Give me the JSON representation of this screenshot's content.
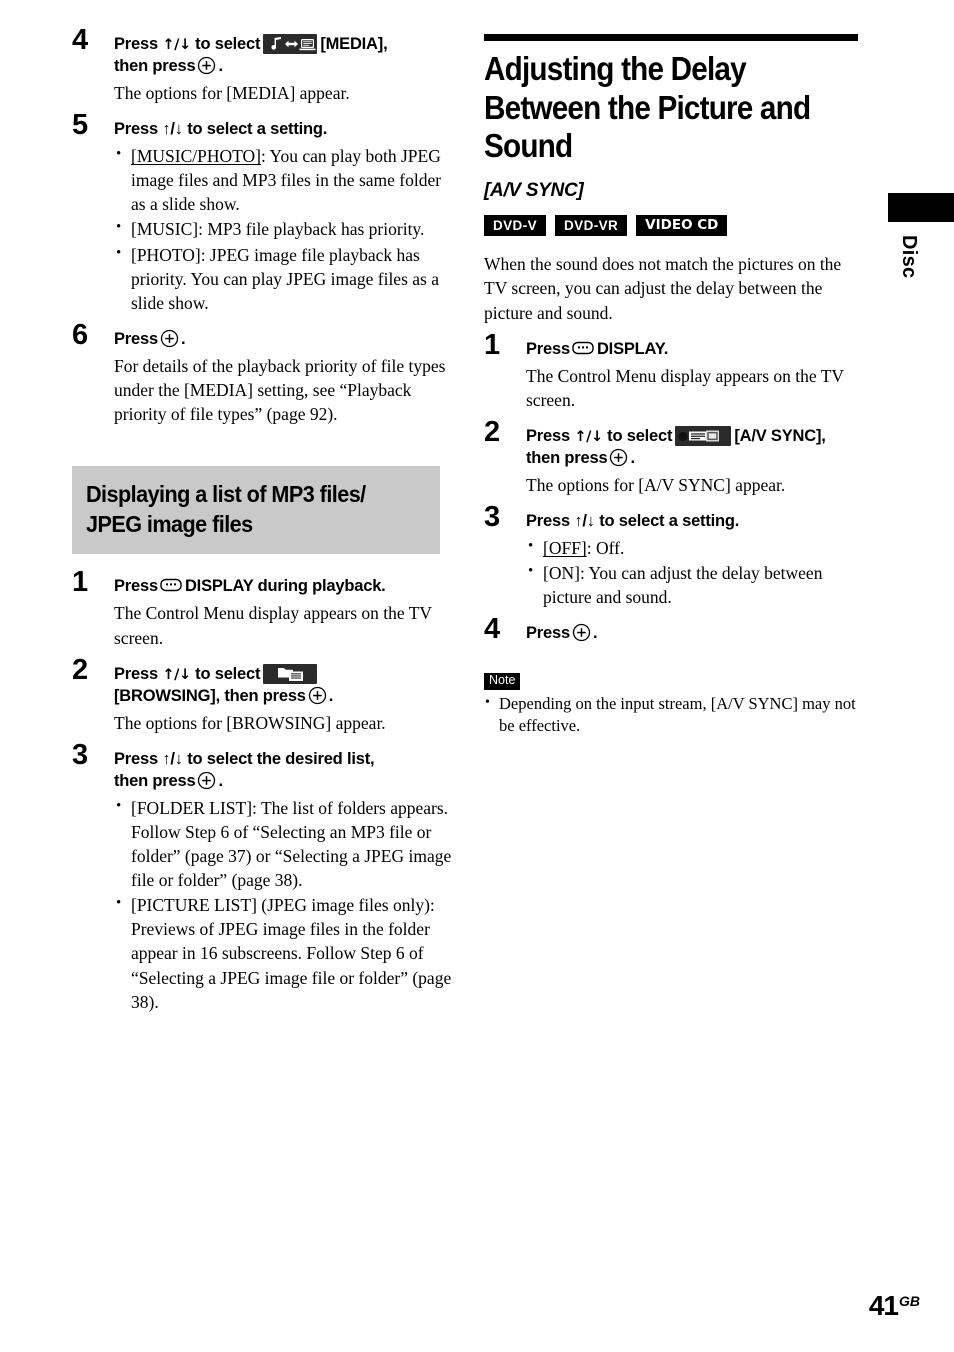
{
  "page": {
    "number": "41",
    "region_suffix": "GB",
    "side_tab_label": "Disc"
  },
  "left_column": {
    "steps_continued": [
      {
        "num": "4",
        "head_before": "Press",
        "arrows": "↑/↓",
        "head_mid": "to select",
        "icon": "media-icon",
        "head_after": "[MEDIA],",
        "head_line2_before": "then press",
        "head_line2_after": ".",
        "body": "The options for [MEDIA] appear."
      },
      {
        "num": "5",
        "head": "Press ↑/↓ to select a setting.",
        "bullets": [
          {
            "label": "[MUSIC/PHOTO]",
            "underline": true,
            "text": ": You can play both JPEG image files and MP3 files in the same folder as a slide show."
          },
          {
            "label": "[MUSIC]",
            "underline": false,
            "text": ": MP3 file playback has priority."
          },
          {
            "label": "[PHOTO]",
            "underline": false,
            "text": ": JPEG image file playback has priority. You can play JPEG image files as a slide show."
          }
        ]
      },
      {
        "num": "6",
        "head_before": "Press",
        "head_after": ".",
        "body": "For details of the playback priority of file types under the [MEDIA] setting, see “Playback priority of file types” (page 92)."
      }
    ],
    "gray_heading": "Displaying a list of MP3 files/ JPEG image files",
    "steps": [
      {
        "num": "1",
        "head_before": "Press",
        "head_after": "DISPLAY during playback.",
        "body": "The Control Menu display appears on the TV screen."
      },
      {
        "num": "2",
        "head_before": "Press",
        "arrows": "↑/↓",
        "head_mid": "to select",
        "icon": "browsing-icon",
        "head_line2_before": "[BROWSING], then press",
        "head_line2_after": ".",
        "body": "The options for [BROWSING] appear."
      },
      {
        "num": "3",
        "head_line1": "Press ↑/↓ to select the desired list,",
        "head_line2_before": "then press",
        "head_line2_after": ".",
        "bullets": [
          {
            "label": "[FOLDER LIST]",
            "underline": false,
            "text": ": The list of folders appears. Follow Step 6 of “Selecting an MP3 file or folder” (page 37) or “Selecting a JPEG image file or folder” (page 38)."
          },
          {
            "label": "[PICTURE LIST] (JPEG image files only)",
            "underline": false,
            "text": ": Previews of JPEG image files in the folder appear in 16 subscreens. Follow Step 6 of “Selecting a JPEG image file or folder” (page 38)."
          }
        ]
      }
    ]
  },
  "right_column": {
    "chapter_title": "Adjusting the Delay Between the Picture and Sound",
    "subtitle": "[A/V SYNC]",
    "badges": [
      "DVD-V",
      "DVD-VR",
      "VIDEO CD"
    ],
    "intro": "When the sound does not match the pictures on the TV screen, you can adjust the delay between the picture and sound.",
    "steps": [
      {
        "num": "1",
        "head_before": "Press",
        "head_after": "DISPLAY.",
        "body": "The Control Menu display appears on the TV screen."
      },
      {
        "num": "2",
        "head_before": "Press",
        "arrows": "↑/↓",
        "head_mid": "to select",
        "icon": "avsync-icon",
        "head_after": "[A/V SYNC],",
        "head_line2_before": "then press",
        "head_line2_after": ".",
        "body": "The options for [A/V SYNC] appear."
      },
      {
        "num": "3",
        "head": "Press ↑/↓ to select a setting.",
        "bullets": [
          {
            "label": "[OFF]",
            "underline": true,
            "text": ": Off."
          },
          {
            "label": "[ON]",
            "underline": false,
            "text": ": You can adjust the delay between picture and sound."
          }
        ]
      },
      {
        "num": "4",
        "head_before": "Press",
        "head_after": "."
      }
    ],
    "note": {
      "tag": "Note",
      "items": [
        "Depending on the input stream, [A/V SYNC] may not be effective."
      ]
    }
  },
  "colors": {
    "gray_heading_bg": "#c9c9c9",
    "icon_box_bg": "#2b2b2b",
    "rule": "#000000"
  }
}
